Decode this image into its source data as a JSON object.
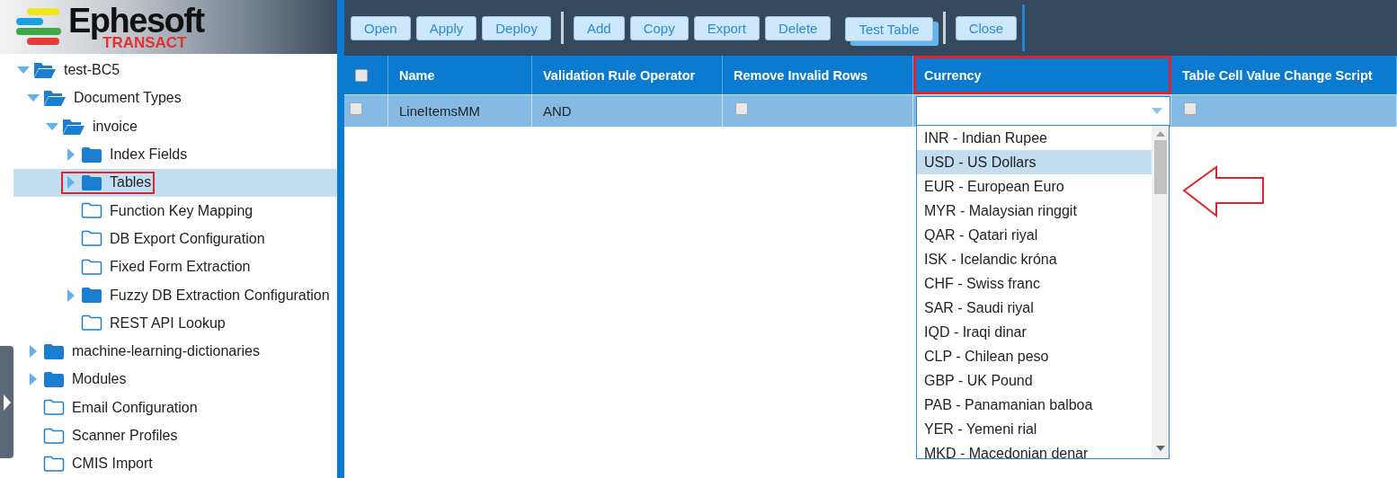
{
  "logo": {
    "name": "Ephesoft",
    "subtitle": "TRANSACT"
  },
  "toolbar": {
    "groups": [
      [
        {
          "label": "Open",
          "pressed": false
        },
        {
          "label": "Apply",
          "pressed": false
        },
        {
          "label": "Deploy",
          "pressed": false
        }
      ],
      [
        {
          "label": "Add",
          "pressed": false
        },
        {
          "label": "Copy",
          "pressed": false
        },
        {
          "label": "Export",
          "pressed": false
        },
        {
          "label": "Delete",
          "pressed": false
        },
        {
          "label": "Test Table",
          "pressed": true
        }
      ],
      [
        {
          "label": "Close",
          "pressed": false
        }
      ]
    ]
  },
  "tree": [
    {
      "label": "test-BC5",
      "kind": "branch",
      "expanded": true,
      "selected": false,
      "highlighted": false,
      "children": [
        {
          "label": "Document Types",
          "kind": "branch",
          "expanded": true,
          "selected": false,
          "highlighted": false,
          "children": [
            {
              "label": "invoice",
              "kind": "branch",
              "expanded": true,
              "selected": false,
              "highlighted": false,
              "children": [
                {
                  "label": "Index Fields",
                  "kind": "branch",
                  "expanded": false,
                  "selected": false,
                  "highlighted": false
                },
                {
                  "label": "Tables",
                  "kind": "branch",
                  "expanded": false,
                  "selected": true,
                  "highlighted": true
                },
                {
                  "label": "Function Key Mapping",
                  "kind": "leaf",
                  "selected": false,
                  "highlighted": false
                },
                {
                  "label": "DB Export Configuration",
                  "kind": "leaf",
                  "selected": false,
                  "highlighted": false
                },
                {
                  "label": "Fixed Form Extraction",
                  "kind": "leaf",
                  "selected": false,
                  "highlighted": false
                },
                {
                  "label": "Fuzzy DB Extraction Configuration",
                  "kind": "branch",
                  "expanded": false,
                  "selected": false,
                  "highlighted": false
                },
                {
                  "label": "REST API Lookup",
                  "kind": "leaf",
                  "selected": false,
                  "highlighted": false
                }
              ]
            }
          ]
        },
        {
          "label": "machine-learning-dictionaries",
          "kind": "branch",
          "expanded": false,
          "selected": false,
          "highlighted": false
        },
        {
          "label": "Modules",
          "kind": "branch",
          "expanded": false,
          "selected": false,
          "highlighted": false
        },
        {
          "label": "Email Configuration",
          "kind": "leaf",
          "selected": false,
          "highlighted": false
        },
        {
          "label": "Scanner Profiles",
          "kind": "leaf",
          "selected": false,
          "highlighted": false
        },
        {
          "label": "CMIS Import",
          "kind": "leaf",
          "selected": false,
          "highlighted": false
        }
      ]
    }
  ],
  "table": {
    "select_all": {
      "checked": false
    },
    "columns": [
      {
        "label": "Name",
        "highlighted": false
      },
      {
        "label": "Validation Rule Operator",
        "highlighted": false
      },
      {
        "label": "Remove Invalid Rows",
        "highlighted": false
      },
      {
        "label": "Currency",
        "highlighted": true
      },
      {
        "label": "Table Cell Value Change Script",
        "highlighted": false
      }
    ],
    "rows": [
      {
        "checked": false,
        "cells": [
          {
            "kind": "text",
            "value": "LineItemsMM"
          },
          {
            "kind": "text",
            "value": "AND"
          },
          {
            "kind": "checkbox",
            "checked": false
          },
          {
            "kind": "select",
            "expanded": true
          },
          {
            "kind": "checkbox",
            "checked": false
          }
        ]
      }
    ]
  },
  "currency_dropdown": {
    "options": [
      {
        "label": "INR - Indian Rupee",
        "selected": false
      },
      {
        "label": "USD - US Dollars",
        "selected": true
      },
      {
        "label": "EUR - European Euro",
        "selected": false
      },
      {
        "label": "MYR - Malaysian ringgit",
        "selected": false
      },
      {
        "label": "QAR - Qatari riyal",
        "selected": false
      },
      {
        "label": "ISK - Icelandic króna",
        "selected": false
      },
      {
        "label": "CHF - Swiss franc",
        "selected": false
      },
      {
        "label": "SAR - Saudi riyal",
        "selected": false
      },
      {
        "label": "IQD - Iraqi dinar",
        "selected": false
      },
      {
        "label": "CLP - Chilean peso",
        "selected": false
      },
      {
        "label": "GBP - UK Pound",
        "selected": false
      },
      {
        "label": "PAB - Panamanian balboa",
        "selected": false
      },
      {
        "label": "YER - Yemeni rial",
        "selected": false
      },
      {
        "label": "MKD - Macedonian denar",
        "selected": false
      }
    ]
  }
}
